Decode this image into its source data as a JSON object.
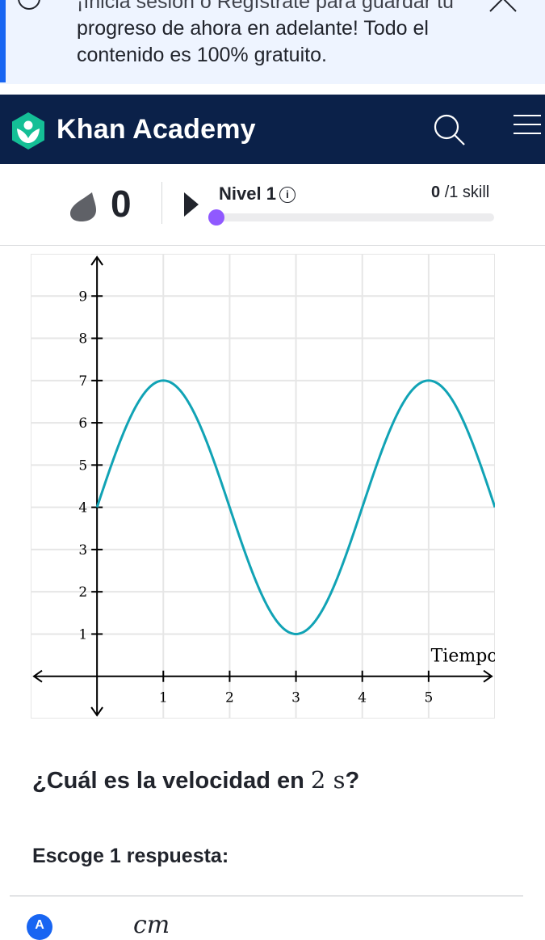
{
  "banner": {
    "line1": "¡Inicia sesión o Regístrate para guardar tu",
    "line2": "progreso de ahora en adelante! Todo el",
    "line3": "contenido es 100% gratuito."
  },
  "navbar": {
    "brand": "Khan Academy",
    "logo_icon": "khan-leaf-logo",
    "search_icon": "search-icon",
    "menu_icon": "hamburger-icon"
  },
  "progress": {
    "streak": "0",
    "level_label": "Nivel 1",
    "skills_count": "0",
    "skills_total": "/1 skill",
    "level_progress": 0
  },
  "chart_data": {
    "type": "line",
    "xlabel": "Tiempo (s)",
    "ylabel": "",
    "xlim": [
      -1,
      6
    ],
    "ylim": [
      -1,
      10
    ],
    "x_ticks": [
      "1",
      "2",
      "3",
      "4",
      "5"
    ],
    "y_ticks": [
      "1",
      "2",
      "3",
      "4",
      "5",
      "6",
      "7",
      "8",
      "9"
    ],
    "grid": true,
    "series": [
      {
        "color": "#11a3b5",
        "function": "y = 4 + 3*sin(pi*x/2)",
        "x": [
          0,
          0.5,
          1,
          1.5,
          2,
          2.5,
          3,
          3.5,
          4,
          4.5,
          5,
          5.5,
          6
        ],
        "values": [
          4,
          6.12,
          7,
          6.12,
          4,
          1.88,
          1,
          1.88,
          4,
          6.12,
          7,
          6.12,
          4
        ]
      }
    ]
  },
  "question": {
    "prefix": "¿Cuál es la velocidad en ",
    "math": "2 s",
    "suffix": "?"
  },
  "choose_label": "Escoge 1 respuesta:",
  "choice_a": {
    "letter": "A",
    "unit_numerator": "cm"
  },
  "colors": {
    "navbar": "#0b2149",
    "banner_bg": "#eef4ff",
    "accent_blue": "#1865f2",
    "level_dot": "#9059ff",
    "curve": "#11a3b5"
  }
}
